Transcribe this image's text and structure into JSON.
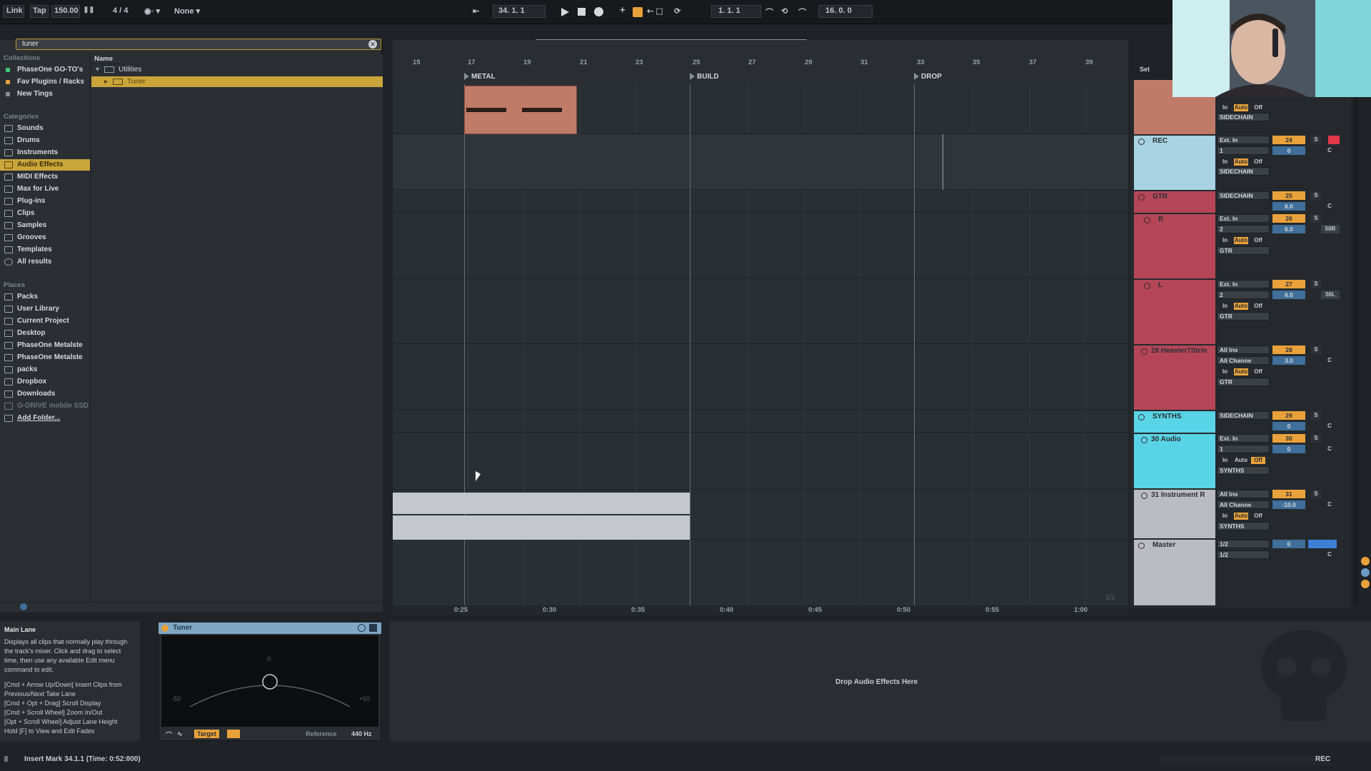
{
  "topbar": {
    "link": "Link",
    "tap": "Tap",
    "tempo": "150.00",
    "signature": "4 / 4",
    "metro_menu": "None",
    "position": "34.  1.  1",
    "loop_start": "1.  1.  1",
    "loop_length": "16.  0.  0"
  },
  "browser": {
    "search_value": "tuner",
    "collections_title": "Collections",
    "collections": [
      {
        "label": "PhaseOne GO-TO's",
        "color": "#3fc77a"
      },
      {
        "label": "Fav Plugins / Racks",
        "color": "#e9a23b"
      },
      {
        "label": "New Tings",
        "color": "#8a8f95"
      }
    ],
    "categories_title": "Categories",
    "categories": [
      "Sounds",
      "Drums",
      "Instruments",
      "Audio Effects",
      "MIDI Effects",
      "Max for Live",
      "Plug-ins",
      "Clips",
      "Samples",
      "Grooves",
      "Templates",
      "All results"
    ],
    "selected_category": "Audio Effects",
    "places_title": "Places",
    "places": [
      "Packs",
      "User Library",
      "Current Project",
      "Desktop",
      "PhaseOne Metalste",
      "PhaseOne Metalste",
      "packs",
      "Dropbox",
      "Downloads",
      "G-DRIVE mobile SSD",
      "Add Folder..."
    ],
    "name_header": "Name",
    "results": [
      {
        "label": "Utilities",
        "selected": false
      },
      {
        "label": "Tuner",
        "selected": true
      }
    ]
  },
  "arrangement": {
    "bars": [
      "15",
      "17",
      "19",
      "21",
      "23",
      "25",
      "27",
      "29",
      "31",
      "33",
      "35",
      "37",
      "39"
    ],
    "locators": [
      "METAL",
      "BUILD",
      "DROP"
    ],
    "times": [
      "0:25",
      "0:30",
      "0:35",
      "0:40",
      "0:45",
      "0:50",
      "0:55",
      "1:00"
    ],
    "set_label": "Set",
    "page_indicator": "1/2"
  },
  "tracks": [
    {
      "name": "",
      "color": "#c07a68",
      "io": [
        "SIDECHAIN"
      ],
      "vol": "",
      "pan": ""
    },
    {
      "name": "REC",
      "color": "#a8d3e3",
      "io": [
        "Ext. In",
        "1",
        "SIDECHAIN"
      ],
      "num": "24",
      "vol": "0",
      "pan": "C"
    },
    {
      "name": "GTR",
      "color": "#b44658",
      "io": [
        "SIDECHAIN"
      ],
      "num": "25",
      "vol": "6.0",
      "pan": "C"
    },
    {
      "name": "R",
      "color": "#b44658",
      "io": [
        "Ext. In",
        "2",
        "GTR"
      ],
      "num": "26",
      "vol": "6.0",
      "pan": "50R"
    },
    {
      "name": "L",
      "color": "#b44658",
      "io": [
        "Ext. In",
        "2",
        "GTR"
      ],
      "num": "27",
      "vol": "6.0",
      "pan": "50L"
    },
    {
      "name": "28 Heavier7Strin",
      "color": "#b44658",
      "io": [
        "All Ins",
        "All Channe",
        "GTR"
      ],
      "num": "28",
      "vol": "3.0",
      "pan": "C"
    },
    {
      "name": "SYNTHS",
      "color": "#59d3e6",
      "io": [
        "SIDECHAIN"
      ],
      "num": "29",
      "vol": "0",
      "pan": "C"
    },
    {
      "name": "30 Audio",
      "color": "#59d3e6",
      "io": [
        "Ext. In",
        "1",
        "SYNTHS"
      ],
      "num": "30",
      "vol": "0",
      "pan": "C"
    },
    {
      "name": "31 Instrument R",
      "color": "#b9bdc2",
      "io": [
        "All Ins",
        "All Channe",
        "SYNTHS"
      ],
      "num": "31",
      "vol": "-10.0",
      "pan": "C"
    },
    {
      "name": "Master",
      "color": "#b9bdc2",
      "io": [
        "1/2",
        "1/2"
      ],
      "num": "0",
      "vol": "0",
      "pan": "C"
    }
  ],
  "monitor": {
    "in": "In",
    "auto": "Auto",
    "off": "Off",
    "solo": "S"
  },
  "info": {
    "title": "Main Lane",
    "body": "Displays all clips that normally play through the track's mixer. Click and drag to select time, then use any available Edit menu command to edit.",
    "shortcuts": [
      "[Cmd + Arrow Up/Down] Insert Clips from Previous/Next Take Lane",
      "[Cmd + Opt + Drag] Scroll Display",
      "[Cmd + Scroll Wheel] Zoom In/Out",
      "[Opt + Scroll Wheel] Adjust Lane Height",
      "Hold [F] to View and Edit Fades"
    ]
  },
  "tuner": {
    "title": "Tuner",
    "center_mark": "0",
    "left_mark": "-50",
    "right_mark": "+50",
    "target_btn": "Target",
    "reference_label": "Reference",
    "reference_value": "440 Hz"
  },
  "device_drop": "Drop Audio Effects Here",
  "status": {
    "text": "Insert Mark 34.1.1 (Time: 0:52:800)",
    "rec": "REC"
  }
}
